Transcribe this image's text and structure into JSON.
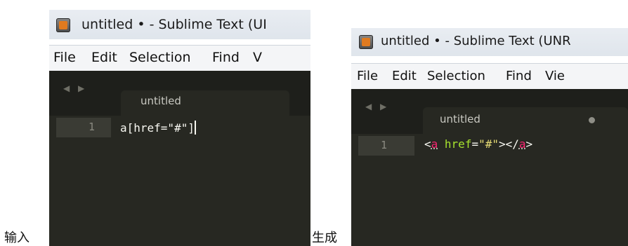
{
  "captions": {
    "input": "输入",
    "output": "生成"
  },
  "left_window": {
    "title": "untitled • - Sublime Text (UI",
    "menu": [
      "File",
      "Edit",
      "Selection",
      "Find",
      "V"
    ],
    "tab_label": "untitled",
    "line_number": "1",
    "code": "a[href=\"#\"]"
  },
  "right_window": {
    "title": "untitled • - Sublime Text (UNR",
    "menu": [
      "File",
      "Edit",
      "Selection",
      "Find",
      "Vie"
    ],
    "tab_label": "untitled",
    "line_number": "1",
    "code_parts": {
      "lt1": "<",
      "tag1": "a",
      "attr": " href",
      "eq": "=",
      "val": "\"#\"",
      "gt_lt": "></",
      "tag2": "a",
      "gt2": ">"
    }
  },
  "theme": {
    "editor_bg": "#272822",
    "tag": "#f92672",
    "attr": "#a6e22e",
    "string": "#e6db74"
  }
}
